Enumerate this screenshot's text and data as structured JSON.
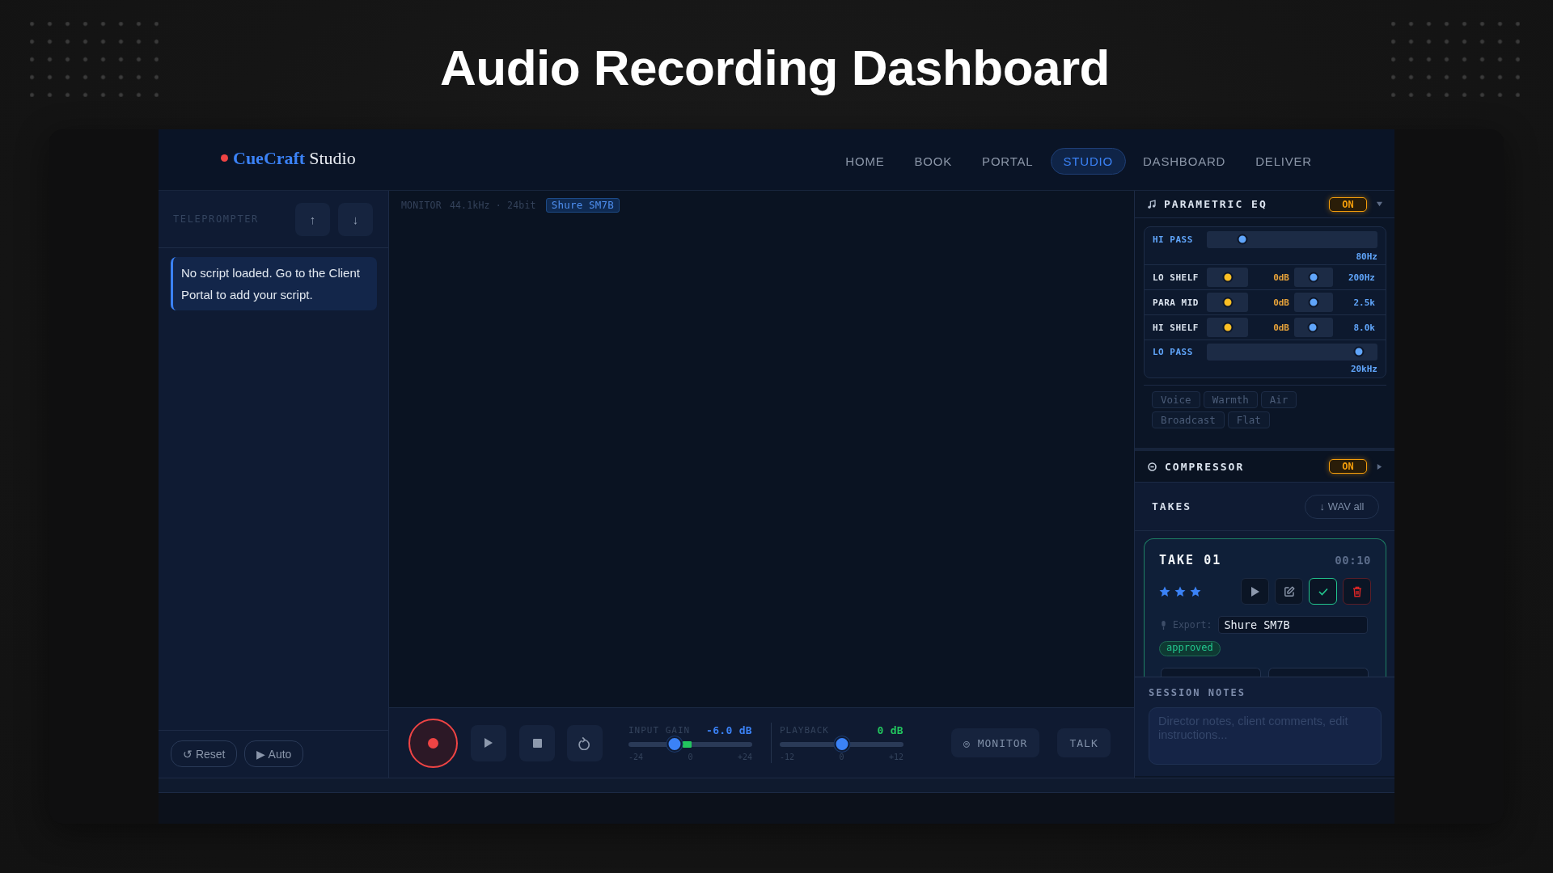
{
  "title": "Audio Recording Dashboard",
  "app": {
    "brand": {
      "name": "CueCraft",
      "suffix": "Studio"
    },
    "nav": [
      {
        "label": "HOME",
        "selected": false
      },
      {
        "label": "BOOK",
        "selected": false
      },
      {
        "label": "PORTAL",
        "selected": false
      },
      {
        "label": "STUDIO",
        "selected": true
      },
      {
        "label": "DASHBOARD",
        "selected": false
      },
      {
        "label": "DELIVER",
        "selected": false
      }
    ],
    "teleprompter": {
      "title": "TELEPROMPTER",
      "scroll_buttons": [
        "↑",
        "↓"
      ],
      "message": "No script loaded. Go to the Client Portal to add your script.",
      "buttons": [
        "↺ Reset",
        "▶ Auto"
      ]
    },
    "monitor": {
      "label": "MONITOR",
      "format": "44.1kHz · 24bit",
      "mic": "Shure SM7B"
    },
    "transport": {
      "faders": [
        {
          "kind": "gain",
          "label": "INPUT GAIN",
          "reading": "-6.0 dB",
          "level": 0.375,
          "ticks": [
            "-24",
            "0",
            "+24"
          ]
        },
        {
          "kind": "playback",
          "label": "PLAYBACK",
          "reading": "0 dB",
          "level": 0.5,
          "ticks": [
            "-12",
            "0",
            "+12"
          ]
        }
      ],
      "buttons": [
        "◎ MONITOR",
        "TALK"
      ]
    },
    "eq": {
      "title": "PARAMETRIC EQ",
      "toggle": "ON",
      "on": true,
      "expanded": true,
      "bands": [
        {
          "kind": "pass",
          "label": "HI PASS",
          "freq": {
            "level": 0.21,
            "reading": "80Hz"
          }
        },
        {
          "kind": "band",
          "label": "LO SHELF",
          "gain": {
            "level": 0.5,
            "reading": "0dB"
          },
          "freq": {
            "level": 0.5,
            "reading": "200Hz"
          }
        },
        {
          "kind": "band",
          "label": "PARA MID",
          "gain": {
            "level": 0.5,
            "reading": "0dB"
          },
          "freq": {
            "level": 0.5,
            "reading": "2.5k"
          }
        },
        {
          "kind": "band",
          "label": "HI SHELF",
          "gain": {
            "level": 0.5,
            "reading": "0dB"
          },
          "freq": {
            "level": 0.47,
            "reading": "8.0k"
          }
        },
        {
          "kind": "pass",
          "label": "LO PASS",
          "freq": {
            "level": 0.89,
            "reading": "20kHz"
          }
        }
      ],
      "presets": [
        "Voice",
        "Warmth",
        "Air",
        "Broadcast",
        "Flat"
      ]
    },
    "compressor": {
      "title": "COMPRESSOR",
      "toggle": "ON",
      "on": true,
      "expanded": false
    },
    "takes": {
      "title": "TAKES",
      "download_all": "↓ WAV all",
      "items": [
        {
          "name": "TAKE 01",
          "duration": "00:10",
          "stars": 3,
          "approved": true,
          "export_label": "Export:",
          "export_value": "Shure SM7B",
          "status": "approved"
        }
      ]
    },
    "session_notes": {
      "title": "SESSION NOTES",
      "placeholder": "Director notes, client comments, edit instructions..."
    }
  }
}
